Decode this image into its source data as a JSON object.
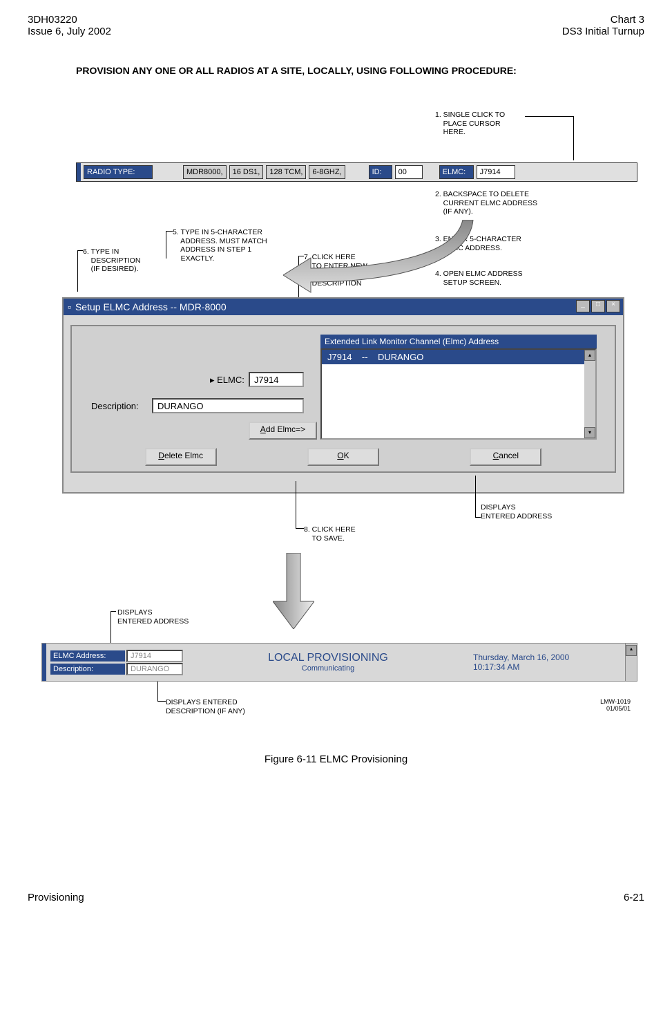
{
  "header": {
    "left_line1": "3DH03220",
    "left_line2": "Issue 6, July 2002",
    "right_line1": "Chart 3",
    "right_line2": "DS3 Initial Turnup"
  },
  "main_title": "PROVISION ANY ONE OR ALL RADIOS AT A SITE, LOCALLY, USING FOLLOWING PROCEDURE:",
  "annotations": {
    "a1": "1. SINGLE CLICK TO\n    PLACE CURSOR\n    HERE.",
    "a2": "2. BACKSPACE TO DELETE\n    CURRENT ELMC ADDRESS\n    (IF ANY).",
    "a3": "3. ENTER 5-CHARACTER\n    ELMC ADDRESS.",
    "a4": "4. OPEN ELMC ADDRESS\n    SETUP SCREEN.",
    "a5": "5. TYPE IN 5-CHARACTER\n    ADDRESS. MUST MATCH\n    ADDRESS IN STEP 1\n    EXACTLY.",
    "a6": "6. TYPE IN\n    DESCRIPTION\n    (IF DESIRED).",
    "a7": "7. CLICK HERE\n    TO ENTER NEW\n    ADDRESS AND\n    DESCRIPTION",
    "a8": "8. CLICK HERE\n    TO SAVE.",
    "disp_entered_1": "DISPLAYS\nENTERED ADDRESS",
    "disp_entered_2": "DISPLAYS\nENTERED ADDRESS",
    "disp_desc": "DISPLAYS ENTERED\nDESCRIPTION (IF ANY)"
  },
  "radio_bar": {
    "label": "RADIO TYPE:",
    "v1": "MDR8000,",
    "v2": "16 DS1,",
    "v3": "128 TCM,",
    "v4": "6-8GHZ,",
    "id_label": "ID:",
    "id_val": "00",
    "elmc_label": "ELMC:",
    "elmc_val": "J7914"
  },
  "setup": {
    "title": "Setup ELMC Address  --  MDR-8000",
    "elmc_label": "ELMC:",
    "elmc_val": "J7914",
    "desc_label": "Description:",
    "desc_val": "DURANGO",
    "add_btn": "Add Elmc=>",
    "ext_header": "Extended Link Monitor Channel (Elmc) Address",
    "ext_item": "J7914    --    DURANGO",
    "delete_btn": "Delete Elmc",
    "ok_btn": "OK",
    "cancel_btn": "Cancel"
  },
  "status": {
    "addr_label": "ELMC Address:",
    "addr_val": "J7914",
    "desc_label": "Description:",
    "desc_val": "DURANGO",
    "center_title": "LOCAL PROVISIONING",
    "center_sub": "Communicating",
    "date": "Thursday, March 16, 2000",
    "time": "10:17:34 AM"
  },
  "code": {
    "line1": "LMW-1019",
    "line2": "01/05/01"
  },
  "figure_caption": "Figure 6-11  ELMC Provisioning",
  "footer": {
    "left": "Provisioning",
    "right": "6-21"
  }
}
